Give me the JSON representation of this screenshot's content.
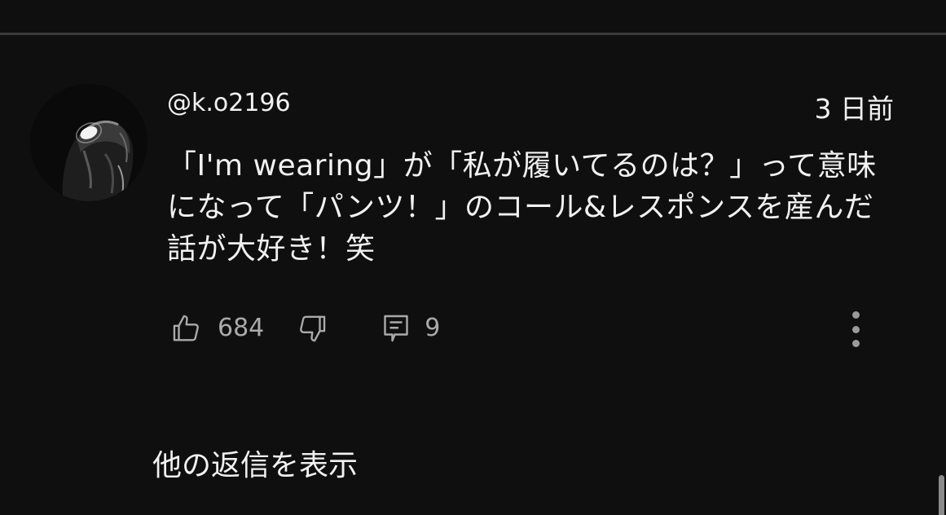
{
  "comment": {
    "author": "@k.o2196",
    "timestamp": "3 日前",
    "text": "「I'm wearing」が「私が履いてるのは？」って意味になって「パンツ！」のコール&レスポンスを産んだ話が大好き！笑",
    "avatar_icon": "masked-figure-avatar"
  },
  "actions": {
    "like_count": "684",
    "reply_count": "9",
    "like_icon": "thumbs-up-icon",
    "dislike_icon": "thumbs-down-icon",
    "reply_icon": "comment-icon",
    "more_icon": "more-vert-icon"
  },
  "replies": {
    "show_label": "他の返信を表示"
  },
  "colors": {
    "background": "#0f0f0f",
    "text_primary": "#f1f1f1",
    "text_secondary": "#aaaaaa",
    "divider": "#3a3a3a"
  }
}
